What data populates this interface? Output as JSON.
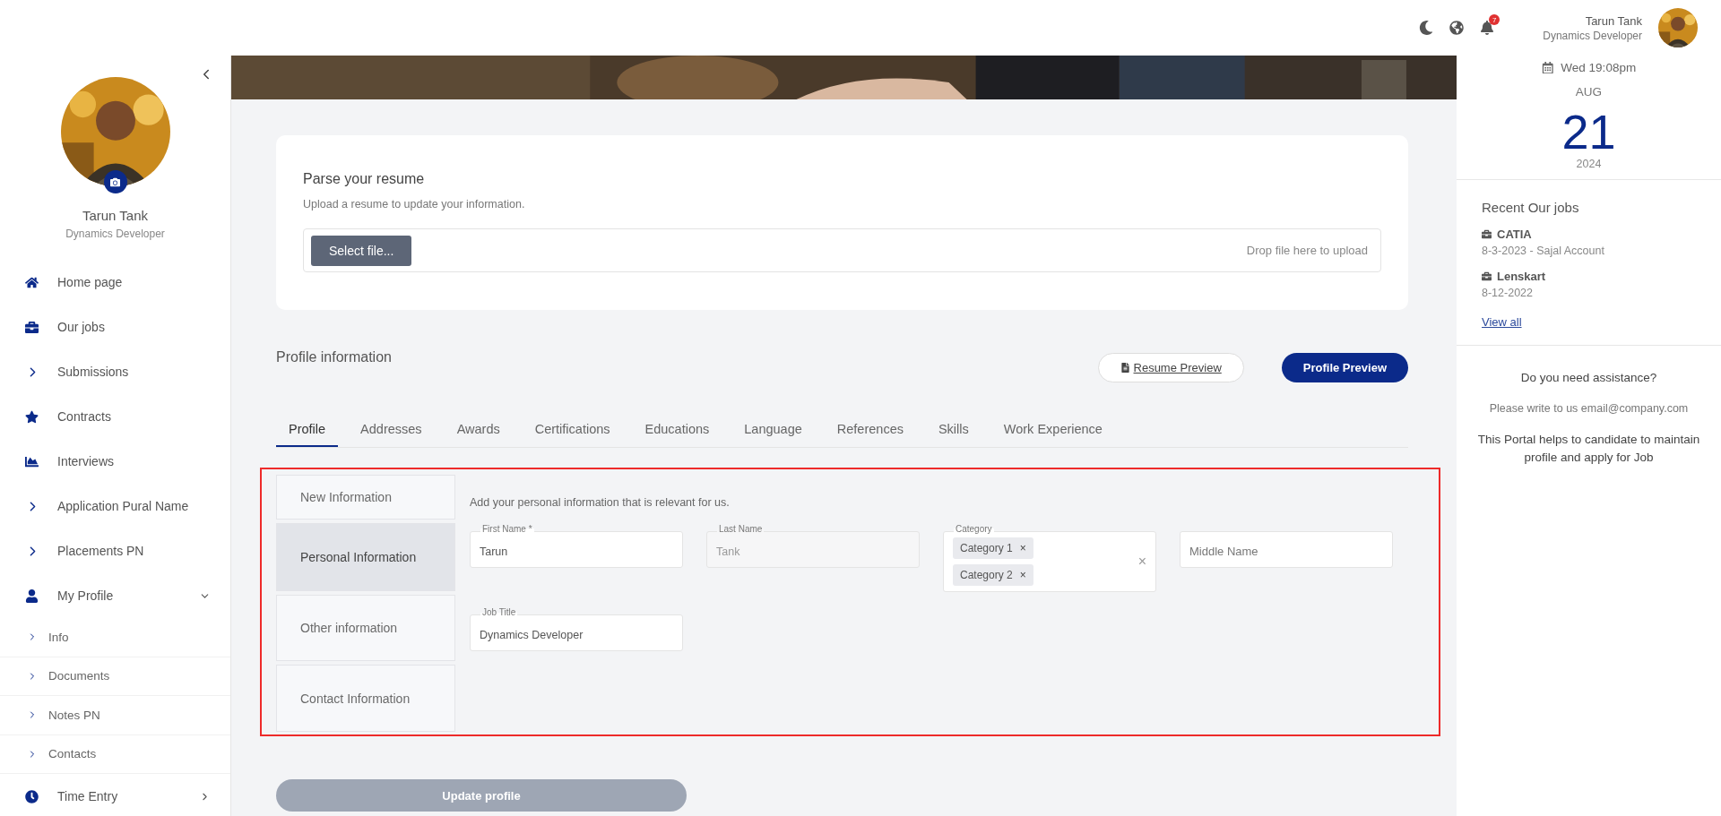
{
  "topbar": {
    "notifications": "7",
    "user": {
      "name": "Tarun Tank",
      "role": "Dynamics Developer"
    }
  },
  "sidebar": {
    "user": {
      "name": "Tarun Tank",
      "role": "Dynamics Developer"
    },
    "items": [
      {
        "label": "Home page",
        "kind": "link"
      },
      {
        "label": "Our jobs",
        "kind": "link"
      },
      {
        "label": "Submissions",
        "kind": "group"
      },
      {
        "label": "Contracts",
        "kind": "link"
      },
      {
        "label": "Interviews",
        "kind": "link"
      },
      {
        "label": "Application Pural Name",
        "kind": "group"
      },
      {
        "label": "Placements PN",
        "kind": "group"
      },
      {
        "label": "My Profile",
        "kind": "link",
        "expanded": true,
        "children": [
          {
            "label": "Info"
          },
          {
            "label": "Documents"
          },
          {
            "label": "Notes PN"
          },
          {
            "label": "Contacts"
          }
        ]
      },
      {
        "label": "Time Entry",
        "kind": "link",
        "expanded": false
      }
    ]
  },
  "resume": {
    "title": "Parse your resume",
    "subtitle": "Upload a resume to update your information.",
    "button": "Select file...",
    "drop_hint": "Drop file here to upload"
  },
  "profile": {
    "title": "Profile information",
    "buttons": [
      {
        "label": "Resume Preview",
        "kind": "link"
      },
      {
        "label": "Profile Preview",
        "kind": "primary"
      }
    ],
    "tabs": [
      {
        "label": "Profile",
        "selected": true
      },
      {
        "label": "Addresses",
        "selected": false
      },
      {
        "label": "Awards",
        "selected": false
      },
      {
        "label": "Certifications",
        "selected": false
      },
      {
        "label": "Educations",
        "selected": false
      },
      {
        "label": "Language",
        "selected": false
      },
      {
        "label": "References",
        "selected": false
      },
      {
        "label": "Skills",
        "selected": false
      },
      {
        "label": "Work Experience",
        "selected": false
      }
    ],
    "sections": [
      {
        "label": "New Information",
        "selected": false
      },
      {
        "label": "Personal Information",
        "selected": true
      },
      {
        "label": "Other information",
        "selected": false
      },
      {
        "label": "Contact Information",
        "selected": false
      }
    ],
    "description": "Add your personal information that is relevant for us.",
    "fields": [
      {
        "kind": "text",
        "label": "First Name *",
        "value": "Tarun"
      },
      {
        "kind": "text",
        "label": "Last Name",
        "value": "Tank",
        "disabled": true
      },
      {
        "kind": "multiselect",
        "label": "Category",
        "chips": [
          "Category 1",
          "Category 2"
        ],
        "clear": "×",
        "chip_remove": "×"
      },
      {
        "kind": "text",
        "placeholder": "Middle Name"
      },
      {
        "kind": "text",
        "label": "Job Title",
        "value": "Dynamics Developer"
      }
    ],
    "submit": {
      "label": "Update profile",
      "disabled": true
    }
  },
  "right_panel": {
    "time": "Wed 19:08pm",
    "month": "AUG",
    "day": "21",
    "year": "2024",
    "recent": {
      "title": "Recent Our jobs",
      "jobs": [
        {
          "title": "CATIA",
          "detail": "8-3-2023 - Sajal Account"
        },
        {
          "title": "Lenskart",
          "detail": "8-12-2022"
        }
      ],
      "view_all": "View all"
    },
    "help": {
      "title": "Do you need assistance?",
      "contact": "Please write to us email@company.com",
      "about": "This Portal helps to candidate to maintain profile and apply for Job"
    }
  }
}
